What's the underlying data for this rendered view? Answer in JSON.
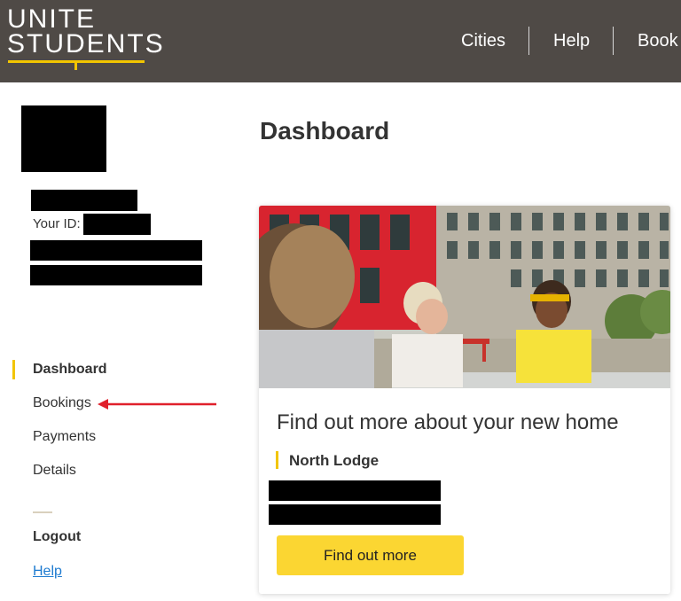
{
  "header": {
    "logo_line1": "UNITE",
    "logo_line2": "STUDENTS",
    "nav": [
      {
        "label": "Cities"
      },
      {
        "label": "Help"
      },
      {
        "label": "Book"
      }
    ]
  },
  "profile": {
    "id_label": "Your ID:"
  },
  "sidebar": {
    "items": [
      {
        "label": "Dashboard",
        "active": true
      },
      {
        "label": "Bookings"
      },
      {
        "label": "Payments"
      },
      {
        "label": "Details"
      }
    ],
    "logout_label": "Logout",
    "help_label": "Help"
  },
  "main": {
    "title": "Dashboard",
    "card": {
      "title": "Find out more about your new home",
      "property": "North Lodge",
      "button_label": "Find out more"
    }
  },
  "colors": {
    "header_bg": "#4f4a46",
    "accent_yellow": "#f2c500",
    "button_yellow": "#fbd632",
    "link_blue": "#1e7bd0",
    "annotation_red": "#e0202b"
  }
}
